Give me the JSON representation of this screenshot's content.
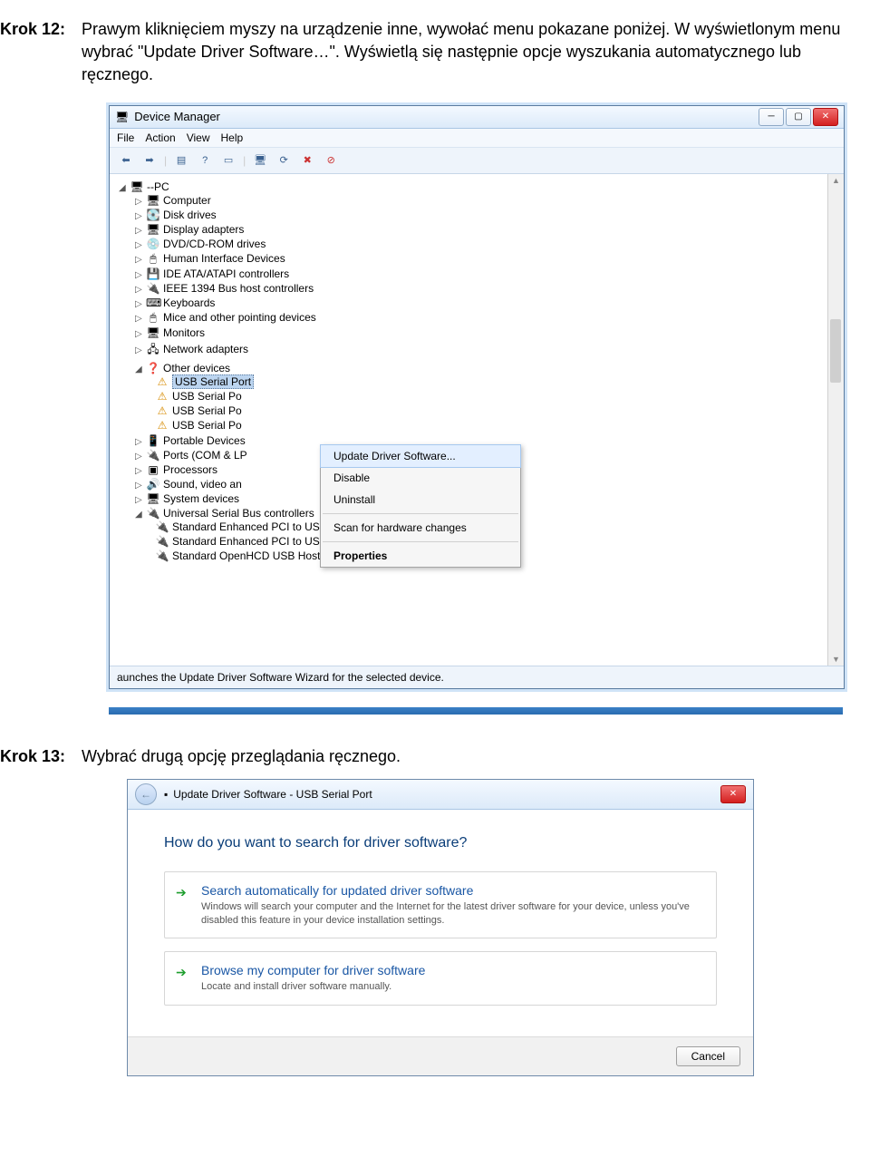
{
  "step12": {
    "label": "Krok 12:",
    "text": "Prawym kliknięciem myszy na urządzenie inne, wywołać menu pokazane poniżej. W wyświetlonym menu wybrać \"Update Driver Software…\". Wyświetlą się następnie opcje wyszukania automatycznego lub ręcznego."
  },
  "step13": {
    "label": "Krok 13:",
    "text": "Wybrać drugą opcję przeglądania ręcznego."
  },
  "devmgr": {
    "title": "Device Manager",
    "menu": [
      "File",
      "Action",
      "View",
      "Help"
    ],
    "root": "--PC",
    "nodes": [
      {
        "label": "Computer",
        "icon": "🖥"
      },
      {
        "label": "Disk drives",
        "icon": "💽"
      },
      {
        "label": "Display adapters",
        "icon": "🖥"
      },
      {
        "label": "DVD/CD-ROM drives",
        "icon": "💿"
      },
      {
        "label": "Human Interface Devices",
        "icon": "🖱"
      },
      {
        "label": "IDE ATA/ATAPI controllers",
        "icon": "💾"
      },
      {
        "label": "IEEE 1394 Bus host controllers",
        "icon": "🔌"
      },
      {
        "label": "Keyboards",
        "icon": "⌨"
      },
      {
        "label": "Mice and other pointing devices",
        "icon": "🖱"
      },
      {
        "label": "Monitors",
        "icon": "🖥"
      },
      {
        "label": "Network adapters",
        "icon": "🖧"
      }
    ],
    "other_label": "Other devices",
    "other_children": [
      "USB Serial Port",
      "USB Serial Po",
      "USB Serial Po",
      "USB Serial Po"
    ],
    "after": [
      {
        "label": "Portable Devices",
        "icon": "📱"
      },
      {
        "label": "Ports (COM & LP",
        "icon": "🔌"
      },
      {
        "label": "Processors",
        "icon": "▣"
      },
      {
        "label": "Sound, video an",
        "icon": "🔊"
      },
      {
        "label": "System devices",
        "icon": "🖥"
      }
    ],
    "usb_label": "Universal Serial Bus controllers",
    "usb_children": [
      "Standard Enhanced PCI to USB Host Controller",
      "Standard Enhanced PCI to USB Host Controller",
      "Standard OpenHCD USB Host Controller"
    ],
    "context": {
      "update": "Update Driver Software...",
      "disable": "Disable",
      "uninstall": "Uninstall",
      "scan": "Scan for hardware changes",
      "properties": "Properties"
    },
    "status": "aunches the Update Driver Software Wizard for the selected device."
  },
  "wizard": {
    "title": "Update Driver Software - USB Serial Port",
    "heading": "How do you want to search for driver software?",
    "opt1": {
      "title": "Search automatically for updated driver software",
      "desc": "Windows will search your computer and the Internet for the latest driver software for your device, unless you've disabled this feature in your device installation settings."
    },
    "opt2": {
      "title": "Browse my computer for driver software",
      "desc": "Locate and install driver software manually."
    },
    "cancel": "Cancel"
  }
}
